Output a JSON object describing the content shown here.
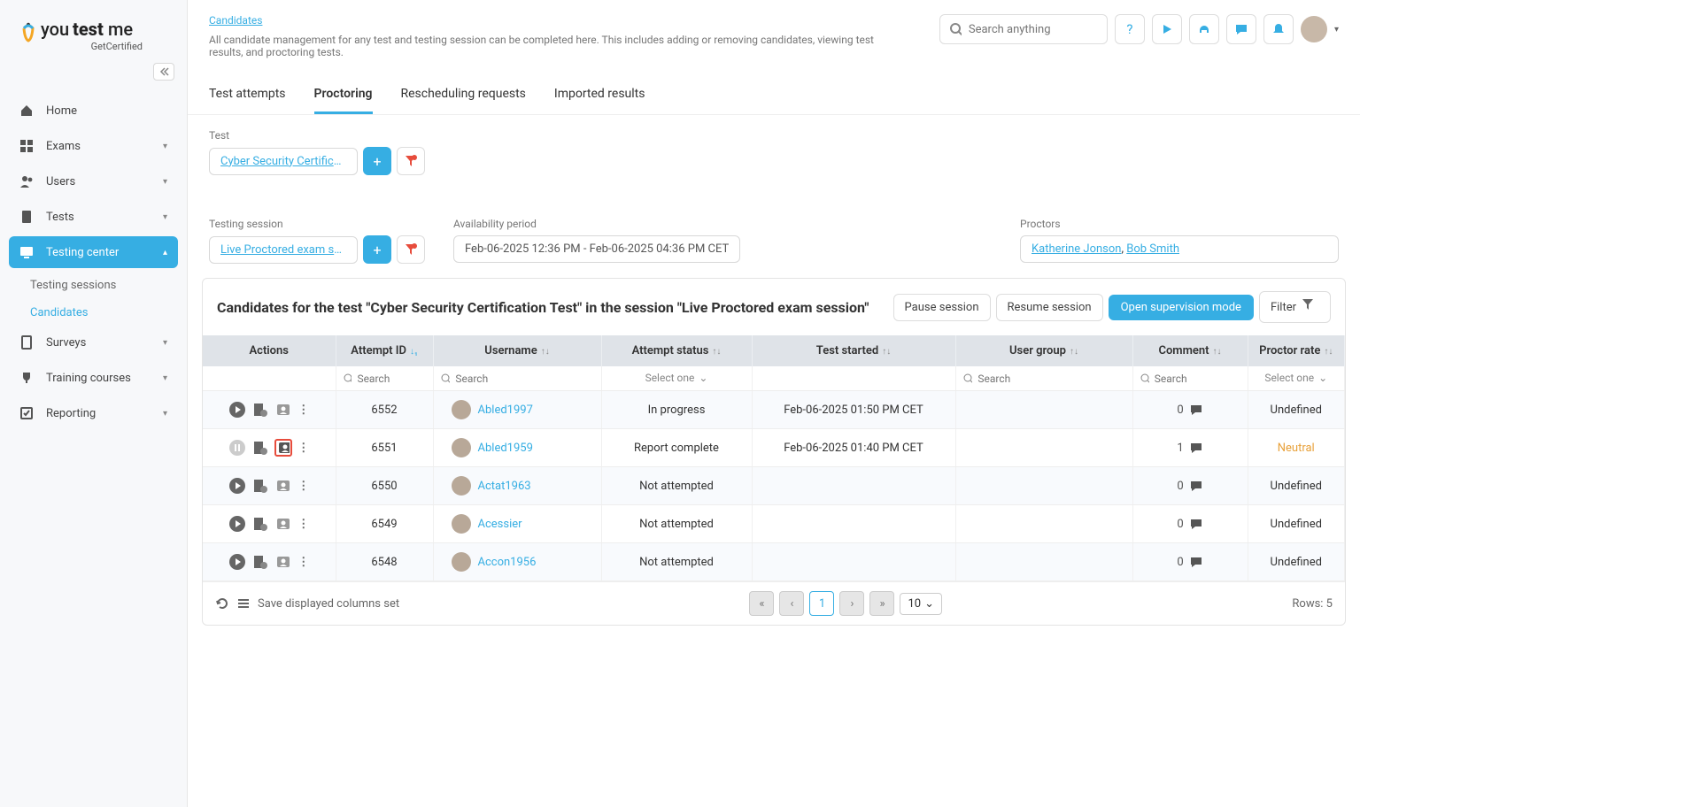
{
  "brand": {
    "main": "youtestme",
    "sub": "GetCertified"
  },
  "sidebar": {
    "items": [
      {
        "label": "Home"
      },
      {
        "label": "Exams"
      },
      {
        "label": "Users"
      },
      {
        "label": "Tests"
      },
      {
        "label": "Testing center"
      },
      {
        "label": "Surveys"
      },
      {
        "label": "Training courses"
      },
      {
        "label": "Reporting"
      }
    ],
    "sub": {
      "sessions": "Testing sessions",
      "candidates": "Candidates"
    }
  },
  "breadcrumb": {
    "label": "Candidates"
  },
  "page_desc": "All candidate management for any test and testing session can be completed here. This includes adding or removing candidates, viewing test results, and proctoring tests.",
  "search_placeholder": "Search anything",
  "tabs": {
    "attempts": "Test attempts",
    "proctoring": "Proctoring",
    "resched": "Rescheduling requests",
    "imported": "Imported results"
  },
  "filters": {
    "test_label": "Test",
    "test_value": "Cyber Security Certificati...",
    "session_label": "Testing session",
    "session_value": "Live Proctored exam ses...",
    "period_label": "Availability period",
    "period_value": "Feb-06-2025 12:36 PM - Feb-06-2025 04:36 PM CET",
    "proctors_label": "Proctors",
    "proctor1": "Katherine Jonson",
    "proctor2": "Bob Smith"
  },
  "panel": {
    "title": "Candidates for the test \"Cyber Security Certification Test\" in the session \"Live Proctored exam session\"",
    "pause": "Pause session",
    "resume": "Resume session",
    "open": "Open supervision mode",
    "filter": "Filter"
  },
  "columns": {
    "actions": "Actions",
    "attempt_id": "Attempt ID",
    "username": "Username",
    "status": "Attempt status",
    "started": "Test started",
    "group": "User group",
    "comment": "Comment",
    "rate": "Proctor rate"
  },
  "filter_row": {
    "search": "Search",
    "select_one": "Select one"
  },
  "rows": [
    {
      "id": "6552",
      "user": "Abled1997",
      "status": "In progress",
      "started": "Feb-06-2025 01:50 PM CET",
      "comment": "0",
      "rate": "Undefined",
      "play": "play",
      "highlight_person": false
    },
    {
      "id": "6551",
      "user": "Abled1959",
      "status": "Report complete",
      "started": "Feb-06-2025 01:40 PM CET",
      "comment": "1",
      "rate": "Neutral",
      "play": "pause",
      "highlight_person": true
    },
    {
      "id": "6550",
      "user": "Actat1963",
      "status": "Not attempted",
      "started": "",
      "comment": "0",
      "rate": "Undefined",
      "play": "play",
      "highlight_person": false
    },
    {
      "id": "6549",
      "user": "Acessier",
      "status": "Not attempted",
      "started": "",
      "comment": "0",
      "rate": "Undefined",
      "play": "play",
      "highlight_person": false
    },
    {
      "id": "6548",
      "user": "Accon1956",
      "status": "Not attempted",
      "started": "",
      "comment": "0",
      "rate": "Undefined",
      "play": "play",
      "highlight_person": false
    }
  ],
  "footer": {
    "cols_text": "Save displayed columns set",
    "page": "1",
    "page_size": "10",
    "rows_text": "Rows: 5"
  }
}
